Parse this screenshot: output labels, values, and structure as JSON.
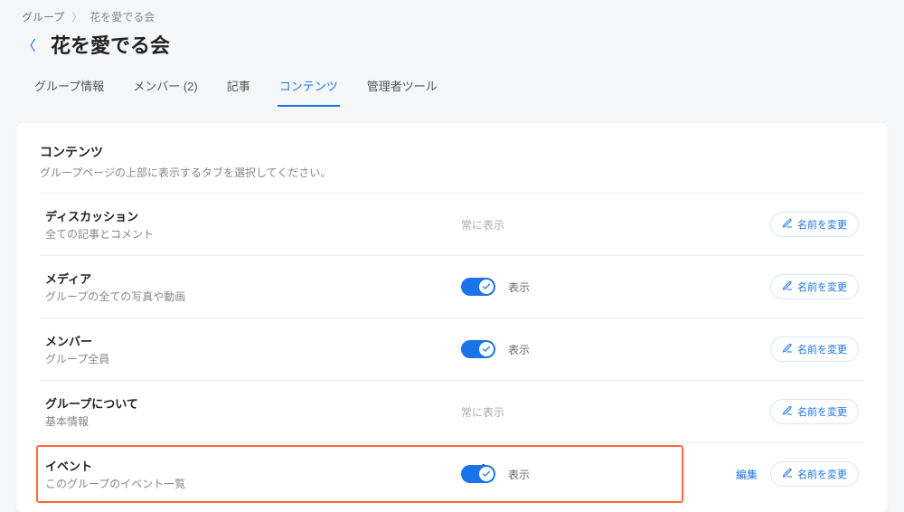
{
  "breadcrumb": {
    "root": "グループ",
    "current": "花を愛でる会"
  },
  "page_title": "花を愛でる会",
  "tabs": [
    {
      "label": "グループ情報"
    },
    {
      "label": "メンバー (2)"
    },
    {
      "label": "記事"
    },
    {
      "label": "コンテンツ",
      "active": true
    },
    {
      "label": "管理者ツール"
    }
  ],
  "section": {
    "title": "コンテンツ",
    "subtitle": "グループページの上部に表示するタブを選択してください。"
  },
  "status_labels": {
    "always": "常に表示",
    "show": "表示"
  },
  "buttons": {
    "rename": "名前を変更",
    "edit": "編集"
  },
  "rows": [
    {
      "name": "ディスカッション",
      "desc": "全ての記事とコメント",
      "mode": "always",
      "rename": true
    },
    {
      "name": "メディア",
      "desc": "グループの全ての写真や動画",
      "mode": "toggle",
      "rename": true
    },
    {
      "name": "メンバー",
      "desc": "グループ全員",
      "mode": "toggle",
      "rename": true
    },
    {
      "name": "グループについて",
      "desc": "基本情報",
      "mode": "always",
      "rename": true
    },
    {
      "name": "イベント",
      "desc": "このグループのイベント一覧",
      "mode": "toggle",
      "rename": true,
      "edit": true,
      "highlighted": true,
      "cursor": true
    }
  ]
}
